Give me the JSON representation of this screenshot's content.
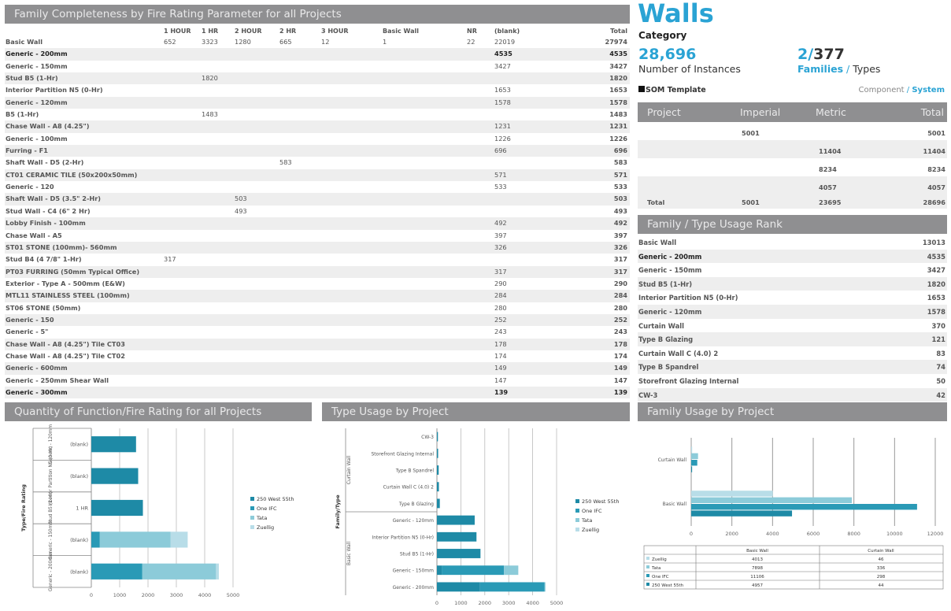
{
  "table": {
    "title": "Family Completeness by Fire Rating Parameter for all Projects",
    "columns": [
      "1 HOUR",
      "1 HR",
      "2 HOUR",
      "2 HR",
      "3 HOUR",
      "Basic Wall",
      "NR",
      "(blank)",
      "Total"
    ],
    "rows": [
      {
        "name": "Basic Wall",
        "c": [
          "652",
          "3323",
          "1280",
          "665",
          "12",
          "1",
          "22",
          "22019"
        ],
        "total": "27974"
      },
      {
        "name": "Generic - 200mm",
        "c": [
          "",
          "",
          "",
          "",
          "",
          "",
          "",
          "4535"
        ],
        "total": "4535",
        "bold": true
      },
      {
        "name": "Generic - 150mm",
        "c": [
          "",
          "",
          "",
          "",
          "",
          "",
          "",
          "3427"
        ],
        "total": "3427"
      },
      {
        "name": "Stud B5 (1-Hr)",
        "c": [
          "",
          "1820",
          "",
          "",
          "",
          "",
          "",
          ""
        ],
        "total": "1820"
      },
      {
        "name": "Interior Partition N5 (0-Hr)",
        "c": [
          "",
          "",
          "",
          "",
          "",
          "",
          "",
          "1653"
        ],
        "total": "1653"
      },
      {
        "name": "Generic - 120mm",
        "c": [
          "",
          "",
          "",
          "",
          "",
          "",
          "",
          "1578"
        ],
        "total": "1578"
      },
      {
        "name": "B5 (1-Hr)",
        "c": [
          "",
          "1483",
          "",
          "",
          "",
          "",
          "",
          ""
        ],
        "total": "1483"
      },
      {
        "name": "Chase Wall - A8 (4.25\")",
        "c": [
          "",
          "",
          "",
          "",
          "",
          "",
          "",
          "1231"
        ],
        "total": "1231"
      },
      {
        "name": "Generic - 100mm",
        "c": [
          "",
          "",
          "",
          "",
          "",
          "",
          "",
          "1226"
        ],
        "total": "1226"
      },
      {
        "name": "Furring - F1",
        "c": [
          "",
          "",
          "",
          "",
          "",
          "",
          "",
          "696"
        ],
        "total": "696"
      },
      {
        "name": "Shaft Wall - D5 (2-Hr)",
        "c": [
          "",
          "",
          "",
          "583",
          "",
          "",
          "",
          ""
        ],
        "total": "583"
      },
      {
        "name": "CT01 CERAMIC TILE (50x200x50mm)",
        "c": [
          "",
          "",
          "",
          "",
          "",
          "",
          "",
          "571"
        ],
        "total": "571"
      },
      {
        "name": "Generic - 120",
        "c": [
          "",
          "",
          "",
          "",
          "",
          "",
          "",
          "533"
        ],
        "total": "533"
      },
      {
        "name": "Shaft Wall - D5 (3.5\" 2-Hr)",
        "c": [
          "",
          "",
          "503",
          "",
          "",
          "",
          "",
          ""
        ],
        "total": "503"
      },
      {
        "name": "Stud Wall - C4 (6\" 2 Hr)",
        "c": [
          "",
          "",
          "493",
          "",
          "",
          "",
          "",
          ""
        ],
        "total": "493"
      },
      {
        "name": "Lobby Finish - 100mm",
        "c": [
          "",
          "",
          "",
          "",
          "",
          "",
          "",
          "492"
        ],
        "total": "492"
      },
      {
        "name": "Chase Wall - A5",
        "c": [
          "",
          "",
          "",
          "",
          "",
          "",
          "",
          "397"
        ],
        "total": "397"
      },
      {
        "name": "ST01 STONE (100mm)- 560mm",
        "c": [
          "",
          "",
          "",
          "",
          "",
          "",
          "",
          "326"
        ],
        "total": "326"
      },
      {
        "name": "Stud B4 (4 7/8\" 1-Hr)",
        "c": [
          "317",
          "",
          "",
          "",
          "",
          "",
          "",
          ""
        ],
        "total": "317"
      },
      {
        "name": "PT03 FURRING (50mm Typical Office)",
        "c": [
          "",
          "",
          "",
          "",
          "",
          "",
          "",
          "317"
        ],
        "total": "317"
      },
      {
        "name": "Exterior - Type A - 500mm (E&W)",
        "c": [
          "",
          "",
          "",
          "",
          "",
          "",
          "",
          "290"
        ],
        "total": "290"
      },
      {
        "name": "MTL11 STAINLESS STEEL (100mm)",
        "c": [
          "",
          "",
          "",
          "",
          "",
          "",
          "",
          "284"
        ],
        "total": "284"
      },
      {
        "name": "ST06 STONE (50mm)",
        "c": [
          "",
          "",
          "",
          "",
          "",
          "",
          "",
          "280"
        ],
        "total": "280"
      },
      {
        "name": "Generic - 150",
        "c": [
          "",
          "",
          "",
          "",
          "",
          "",
          "",
          "252"
        ],
        "total": "252"
      },
      {
        "name": "Generic - 5\"",
        "c": [
          "",
          "",
          "",
          "",
          "",
          "",
          "",
          "243"
        ],
        "total": "243"
      },
      {
        "name": "Chase Wall - A8 (4.25\") Tile CT03",
        "c": [
          "",
          "",
          "",
          "",
          "",
          "",
          "",
          "178"
        ],
        "total": "178"
      },
      {
        "name": "Chase Wall - A8 (4.25\") Tile CT02",
        "c": [
          "",
          "",
          "",
          "",
          "",
          "",
          "",
          "174"
        ],
        "total": "174"
      },
      {
        "name": "Generic - 600mm",
        "c": [
          "",
          "",
          "",
          "",
          "",
          "",
          "",
          "149"
        ],
        "total": "149"
      },
      {
        "name": "Generic - 250mm Shear Wall",
        "c": [
          "",
          "",
          "",
          "",
          "",
          "",
          "",
          "147"
        ],
        "total": "147"
      },
      {
        "name": "Generic - 300mm",
        "c": [
          "",
          "",
          "",
          "",
          "",
          "",
          "",
          "139"
        ],
        "total": "139",
        "bold": true
      }
    ]
  },
  "summary": {
    "title": "Walls",
    "category": "Category",
    "instances_value": "28,696",
    "instances_label": "Number of Instances",
    "families_count": "2/",
    "types_count": "377",
    "families_label": "Families",
    "slash": " / ",
    "types_label": "Types",
    "template": "SOM Template",
    "component": "Component",
    "system": "System",
    "accent": "#2aa3d4"
  },
  "project_table": {
    "headers": [
      "Project",
      "Imperial",
      "Metric",
      "Total"
    ],
    "rows": [
      [
        "",
        "5001",
        "",
        "5001"
      ],
      [
        "",
        "",
        "11404",
        "11404"
      ],
      [
        "",
        "",
        "8234",
        "8234"
      ],
      [
        "",
        "",
        "4057",
        "4057"
      ]
    ],
    "total": [
      "Total",
      "5001",
      "23695",
      "28696"
    ]
  },
  "rank": {
    "title": "Family / Type Usage Rank",
    "rows": [
      [
        "Basic Wall",
        "13013"
      ],
      [
        "Generic - 200mm",
        "4535"
      ],
      [
        "Generic - 150mm",
        "3427"
      ],
      [
        "Stud B5 (1-Hr)",
        "1820"
      ],
      [
        "Interior Partition N5 (0-Hr)",
        "1653"
      ],
      [
        "Generic - 120mm",
        "1578"
      ],
      [
        "Curtain Wall",
        "370"
      ],
      [
        "Type B Glazing",
        "121"
      ],
      [
        "Curtain Wall C (4.0) 2",
        "83"
      ],
      [
        "Type B Spandrel",
        "74"
      ],
      [
        "Storefront Glazing Internal",
        "50"
      ],
      [
        "CW-3",
        "42"
      ]
    ]
  },
  "chart_data": [
    {
      "type": "bar",
      "title": "Quantity of Function/Fire Rating for all Projects",
      "ylabel": "Type/Fire Rating",
      "groups": [
        "Generic - 120mm",
        "Interior Partition N5 (0-Hr)",
        "Stud B5 (1-Hr)",
        "Generic - 150mm",
        "Generic - 200mm"
      ],
      "categories": [
        "(blank)",
        "(blank)",
        "1 HR",
        "(blank)",
        "(blank)"
      ],
      "series": [
        {
          "name": "250 West 55th",
          "values": [
            1578,
            1653,
            1820,
            0,
            0
          ]
        },
        {
          "name": "One IFC",
          "values": [
            0,
            0,
            0,
            300,
            1800
          ]
        },
        {
          "name": "Tata",
          "values": [
            0,
            0,
            0,
            2500,
            2600
          ]
        },
        {
          "name": "Zuellig",
          "values": [
            0,
            0,
            0,
            600,
            100
          ]
        }
      ],
      "stacked": true,
      "xlim": [
        0,
        5000
      ],
      "xticks": [
        "0",
        "1000",
        "2000",
        "3000",
        "4000",
        "5000"
      ]
    },
    {
      "type": "bar",
      "title": "Type Usage by Project",
      "ylabel": "Family/Type",
      "groups": [
        "Curtain Wall",
        "Basic Wall"
      ],
      "categories": [
        "CW-3",
        "Storefront Glazing Internal",
        "Type B Spandrel",
        "Curtain Wall C (4.0) 2",
        "Type B Glazing",
        "Generic - 120mm",
        "Interior Partition N5 (0-Hr)",
        "Stud B5 (1-Hr)",
        "Generic - 150mm",
        "Generic - 200mm"
      ],
      "series": [
        {
          "name": "250 West 55th",
          "values": [
            42,
            50,
            74,
            83,
            121,
            1578,
            1653,
            1820,
            200,
            1800
          ]
        },
        {
          "name": "One IFC",
          "values": [
            0,
            0,
            0,
            0,
            0,
            0,
            0,
            0,
            2600,
            2700
          ]
        },
        {
          "name": "Tata",
          "values": [
            0,
            0,
            0,
            0,
            0,
            0,
            0,
            0,
            600,
            35
          ]
        },
        {
          "name": "Zuellig",
          "values": [
            0,
            0,
            0,
            0,
            0,
            0,
            0,
            0,
            0,
            0
          ]
        }
      ],
      "stacked": true,
      "xlim": [
        0,
        5000
      ],
      "xticks": [
        "0",
        "1000",
        "2000",
        "3000",
        "4000",
        "5000"
      ]
    },
    {
      "type": "bar",
      "title": "Family Usage by Project",
      "categories": [
        "Curtain Wall",
        "Basic Wall"
      ],
      "series": [
        {
          "name": "Zuellig",
          "values": [
            46,
            4013
          ]
        },
        {
          "name": "Tata",
          "values": [
            336,
            7898
          ]
        },
        {
          "name": "One IFC",
          "values": [
            298,
            11106
          ]
        },
        {
          "name": "250 West 55th",
          "values": [
            44,
            4957
          ]
        }
      ],
      "xlim": [
        0,
        12000
      ],
      "xticks": [
        "0",
        "2000",
        "4000",
        "6000",
        "8000",
        "10000",
        "12000"
      ],
      "table_headers": [
        "Basic Wall",
        "Curtain Wall"
      ],
      "table_rows": [
        [
          "Zuellig",
          "4013",
          "46"
        ],
        [
          "Tata",
          "7898",
          "336"
        ],
        [
          "One IFC",
          "11106",
          "298"
        ],
        [
          "250 West 55th",
          "4957",
          "44"
        ]
      ]
    }
  ],
  "legend": [
    "250 West 55th",
    "One IFC",
    "Tata",
    "Zuellig"
  ],
  "colors": {
    "s1": "#1e8aa6",
    "s2": "#2a9ab6",
    "s3": "#8ccbd9",
    "s4": "#b8dde8",
    "header": "#8f8f91"
  }
}
